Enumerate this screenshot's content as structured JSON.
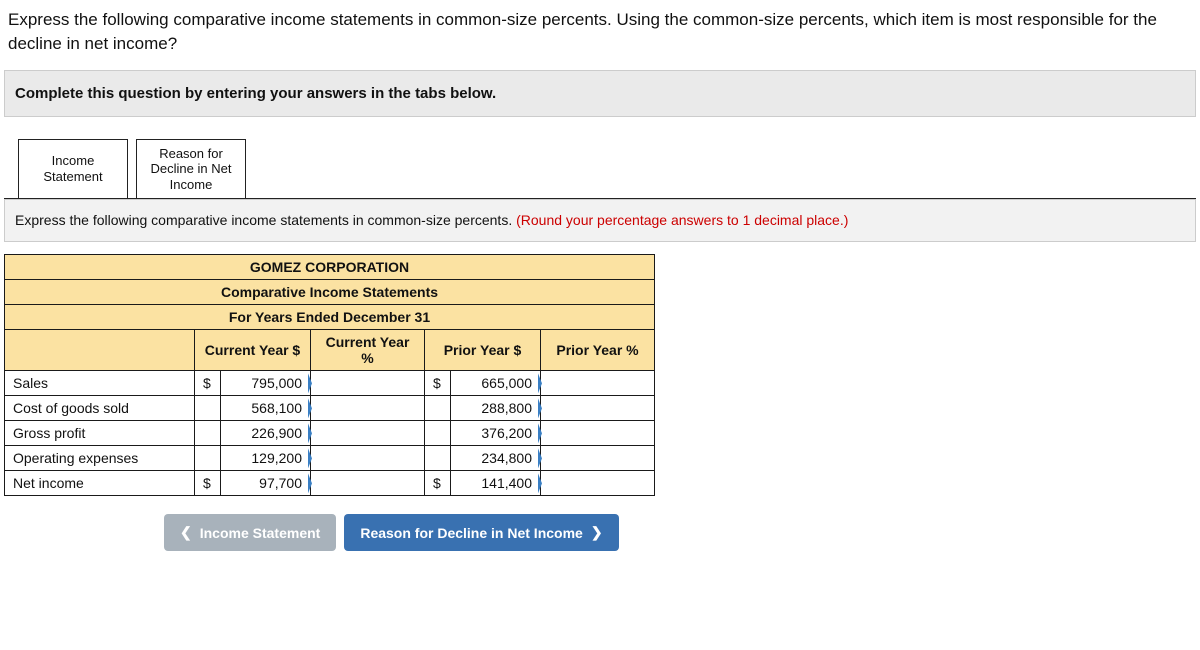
{
  "question": "Express the following comparative income statements in common-size percents. Using the common-size percents, which item is most responsible for the decline in net income?",
  "instruction": "Complete this question by entering your answers in the tabs below.",
  "tabs": [
    {
      "label": "Income Statement"
    },
    {
      "label": "Reason for Decline in Net Income"
    }
  ],
  "sub_instruction": {
    "text": "Express the following comparative income statements in common-size percents. ",
    "hint": "(Round your percentage answers to 1 decimal place.)"
  },
  "sheet": {
    "company": "GOMEZ CORPORATION",
    "title2": "Comparative Income Statements",
    "title3": "For Years Ended December 31",
    "col_headers": {
      "cy_amt": "Current Year $",
      "cy_pct": "Current Year %",
      "py_amt": "Prior Year $",
      "py_pct": "Prior Year %"
    },
    "rows": [
      {
        "label": "Sales",
        "cy_prefix": "$",
        "cy": "795,000",
        "py_prefix": "$",
        "py": "665,000"
      },
      {
        "label": "Cost of goods sold",
        "cy_prefix": "",
        "cy": "568,100",
        "py_prefix": "",
        "py": "288,800"
      },
      {
        "label": "Gross profit",
        "cy_prefix": "",
        "cy": "226,900",
        "py_prefix": "",
        "py": "376,200"
      },
      {
        "label": "Operating expenses",
        "cy_prefix": "",
        "cy": "129,200",
        "py_prefix": "",
        "py": "234,800"
      },
      {
        "label": "Net income",
        "cy_prefix": "$",
        "cy": "97,700",
        "py_prefix": "$",
        "py": "141,400"
      }
    ]
  },
  "nav": {
    "prev": "Income Statement",
    "next": "Reason for Decline in Net Income"
  },
  "chart_data": {
    "type": "table",
    "title": "GOMEZ CORPORATION — Comparative Income Statements — For Years Ended December 31",
    "columns": [
      "Line item",
      "Current Year $",
      "Prior Year $"
    ],
    "rows": [
      [
        "Sales",
        795000,
        665000
      ],
      [
        "Cost of goods sold",
        568100,
        288800
      ],
      [
        "Gross profit",
        226900,
        376200
      ],
      [
        "Operating expenses",
        129200,
        234800
      ],
      [
        "Net income",
        97700,
        141400
      ]
    ]
  }
}
